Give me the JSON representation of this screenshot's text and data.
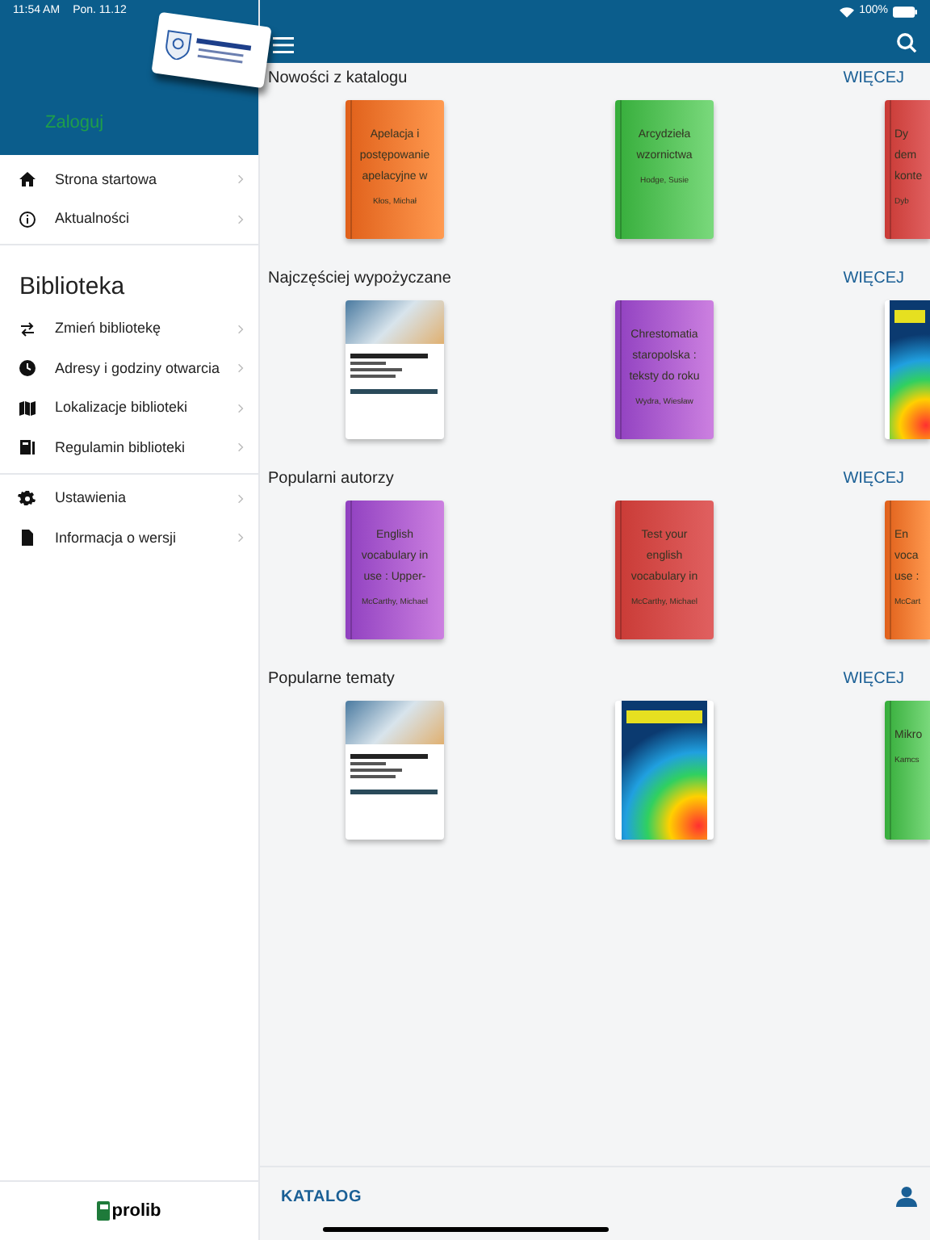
{
  "status_bar": {
    "time": "11:54 AM",
    "date": "Pon. 11.12",
    "battery": "100%"
  },
  "sidebar": {
    "login": "Zaloguj",
    "groups": [
      {
        "items": [
          {
            "kind": "home",
            "label": "Strona startowa"
          },
          {
            "kind": "info",
            "label": "Aktualności"
          }
        ]
      },
      {
        "heading": "Biblioteka",
        "items": [
          {
            "kind": "swap",
            "label": "Zmień bibliotekę"
          },
          {
            "kind": "clock",
            "label": "Adresy i godziny otwarcia"
          },
          {
            "kind": "map",
            "label": "Lokalizacje biblioteki"
          },
          {
            "kind": "book",
            "label": "Regulamin biblioteki"
          }
        ]
      },
      {
        "items": [
          {
            "kind": "gear",
            "label": "Ustawienia"
          },
          {
            "kind": "file",
            "label": "Informacja o wersji"
          }
        ]
      }
    ],
    "footer": "prolib"
  },
  "sections": [
    {
      "title": "Nowości z katalogu",
      "more": "WIĘCEJ",
      "books": [
        {
          "kind": "text",
          "title": "Apelacja i postępowanie apelacyjne w",
          "author": "Kłos, Michał",
          "color": "#f07a2a"
        },
        {
          "kind": "text",
          "title": "Arcydzieła wzornictwa",
          "author": "Hodge, Susie",
          "color": "#4cbf50"
        },
        {
          "kind": "text",
          "title": "Dy dem konte",
          "author": "Dyb",
          "color": "#d9453f"
        }
      ]
    },
    {
      "title": "Najczęściej wypożyczane",
      "more": "WIĘCEJ",
      "books": [
        {
          "kind": "photo"
        },
        {
          "kind": "text",
          "title": "Chrestomatia staropolska : teksty do roku",
          "author": "Wydra, Wiesław",
          "color": "#a84fd0"
        },
        {
          "kind": "rainbow"
        }
      ]
    },
    {
      "title": "Popularni autorzy",
      "more": "WIĘCEJ",
      "books": [
        {
          "kind": "text",
          "title": "English vocabulary in use : Upper-",
          "author": "McCarthy, Michael",
          "color": "#a84fd0"
        },
        {
          "kind": "text",
          "title": "Test your english vocabulary in",
          "author": "McCarthy, Michael",
          "color": "#d9453f"
        },
        {
          "kind": "text",
          "title": "En voca use :",
          "author": "McCart",
          "color": "#f07a2a"
        }
      ]
    },
    {
      "title": "Popularne tematy",
      "more": "WIĘCEJ",
      "books": [
        {
          "kind": "photo"
        },
        {
          "kind": "rainbow"
        },
        {
          "kind": "text",
          "title": "Mikro",
          "author": "Kamcs",
          "color": "#4cbf50"
        }
      ]
    }
  ],
  "bottom_bar": {
    "tab": "KATALOG"
  }
}
